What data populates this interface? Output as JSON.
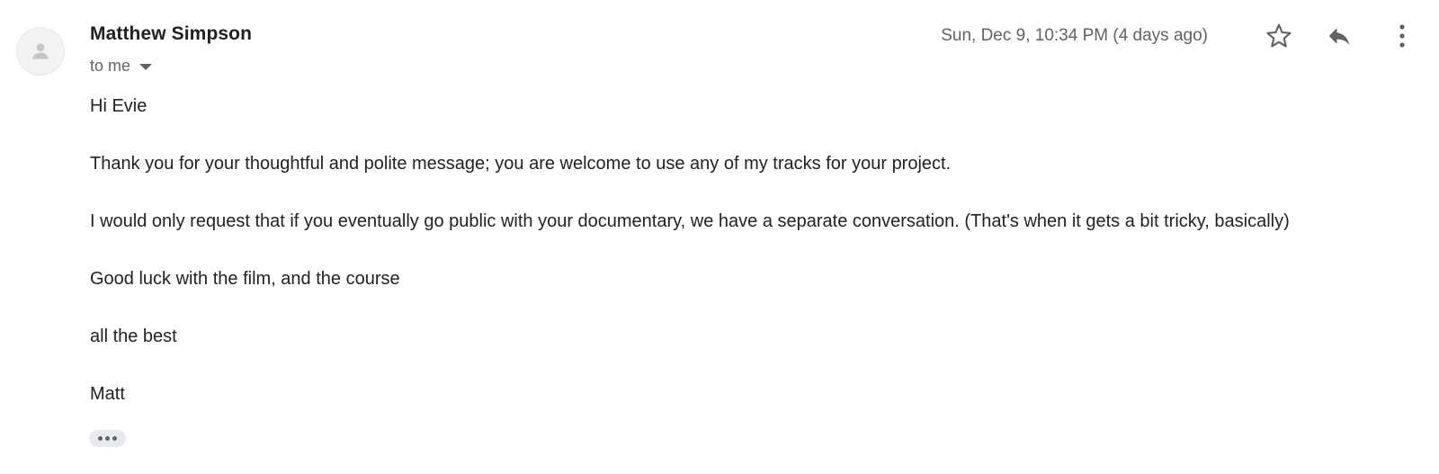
{
  "email": {
    "sender_name": "Matthew Simpson",
    "recipients_label": "to me",
    "timestamp": "Sun, Dec 9, 10:34 PM (4 days ago)",
    "body_lines": [
      "Hi Evie",
      "Thank you for your thoughtful and polite message; you are welcome to use any of my tracks for your project.",
      "I would only request that if you eventually go public with your documentary, we have a separate conversation. (That's when it gets a bit tricky, basically)",
      "Good luck with the film, and the course",
      "all the best",
      "Matt"
    ]
  },
  "icons": {
    "avatar": "person-icon",
    "recipients_toggle": "caret-down-icon",
    "star": "star-outline-icon",
    "reply": "reply-icon",
    "more": "more-vertical-icon",
    "trimmed": "ellipsis-icon"
  },
  "colors": {
    "sender": "#202124",
    "meta": "#5f6368",
    "body_text": "#222222",
    "avatar_bg": "#f1f3f4",
    "trimmed_bg": "#e8eaed"
  }
}
